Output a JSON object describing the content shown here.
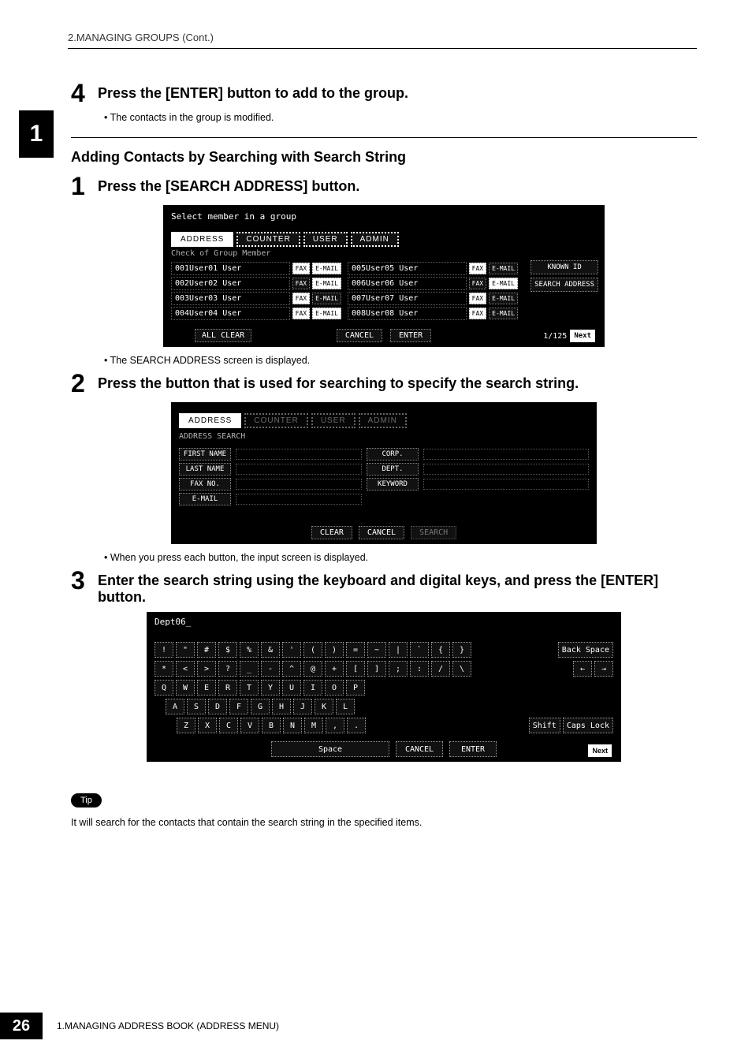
{
  "breadcrumb": "2.MANAGING GROUPS (Cont.)",
  "chapter_tab": "1",
  "step4": {
    "num": "4",
    "text": "Press the [ENTER] button to add to the group.",
    "bullet": "The contacts in the group is modified."
  },
  "subheading": "Adding Contacts by Searching with Search String",
  "step1": {
    "num": "1",
    "text": "Press the [SEARCH ADDRESS] button.",
    "bullet": "The SEARCH ADDRESS screen is displayed.",
    "screen": {
      "title": "Select member in a group",
      "tabs": [
        "ADDRESS",
        "COUNTER",
        "USER",
        "ADMIN"
      ],
      "subtitle": "Check of Group Member",
      "members_left": [
        {
          "label": "001User01 User",
          "fax": true,
          "email": true
        },
        {
          "label": "002User02 User",
          "fax": false,
          "email": true
        },
        {
          "label": "003User03 User",
          "fax": true,
          "email": false
        },
        {
          "label": "004User04 User",
          "fax": true,
          "email": true
        }
      ],
      "members_right": [
        {
          "label": "005User05 User",
          "fax": true,
          "email": false
        },
        {
          "label": "006User06 User",
          "fax": false,
          "email": true
        },
        {
          "label": "007User07 User",
          "fax": true,
          "email": false
        },
        {
          "label": "008User08 User",
          "fax": true,
          "email": false
        }
      ],
      "toggles": {
        "fax": "FAX",
        "email": "E-MAIL"
      },
      "side": [
        "KNOWN ID",
        "SEARCH ADDRESS"
      ],
      "all_clear": "ALL CLEAR",
      "cancel": "CANCEL",
      "enter": "ENTER",
      "page": "1/125",
      "next": "Next"
    }
  },
  "step2": {
    "num": "2",
    "text": "Press the button that is used for searching to specify the search string.",
    "bullet": "When you press each button, the input screen is displayed.",
    "screen": {
      "tabs": [
        "ADDRESS",
        "COUNTER",
        "USER",
        "ADMIN"
      ],
      "subtitle": "ADDRESS SEARCH",
      "left_fields": [
        "FIRST NAME",
        "LAST NAME",
        "FAX NO.",
        "E-MAIL"
      ],
      "right_fields": [
        "CORP.",
        "DEPT.",
        "KEYWORD"
      ],
      "clear": "CLEAR",
      "cancel": "CANCEL",
      "search": "SEARCH"
    }
  },
  "step3": {
    "num": "3",
    "text": "Enter the search string using the keyboard and digital keys, and press the [ENTER] button.",
    "screen": {
      "display": "Dept06_",
      "row1": [
        "!",
        "\"",
        "#",
        "$",
        "%",
        "&",
        "'",
        "(",
        ")",
        "=",
        "~",
        "|",
        "`",
        "{",
        "}"
      ],
      "row2": [
        "*",
        "<",
        ">",
        "?",
        "_",
        "-",
        "^",
        "@",
        "+",
        "[",
        "]",
        ";",
        ":",
        "/",
        "\\"
      ],
      "row3": [
        "Q",
        "W",
        "E",
        "R",
        "T",
        "Y",
        "U",
        "I",
        "O",
        "P"
      ],
      "row4": [
        "A",
        "S",
        "D",
        "F",
        "G",
        "H",
        "J",
        "K",
        "L"
      ],
      "row5": [
        "Z",
        "X",
        "C",
        "V",
        "B",
        "N",
        "M",
        ",",
        "."
      ],
      "backspace": "Back Space",
      "left_arrow": "←",
      "right_arrow": "→",
      "shift": "Shift",
      "capslock": "Caps Lock",
      "space": "Space",
      "cancel": "CANCEL",
      "enter": "ENTER",
      "next": "Next"
    }
  },
  "tip": {
    "badge": "Tip",
    "text": "It will search for the contacts that contain the search string in the specified items."
  },
  "footer": {
    "pagenum": "26",
    "text": "1.MANAGING ADDRESS BOOK (ADDRESS MENU)"
  }
}
